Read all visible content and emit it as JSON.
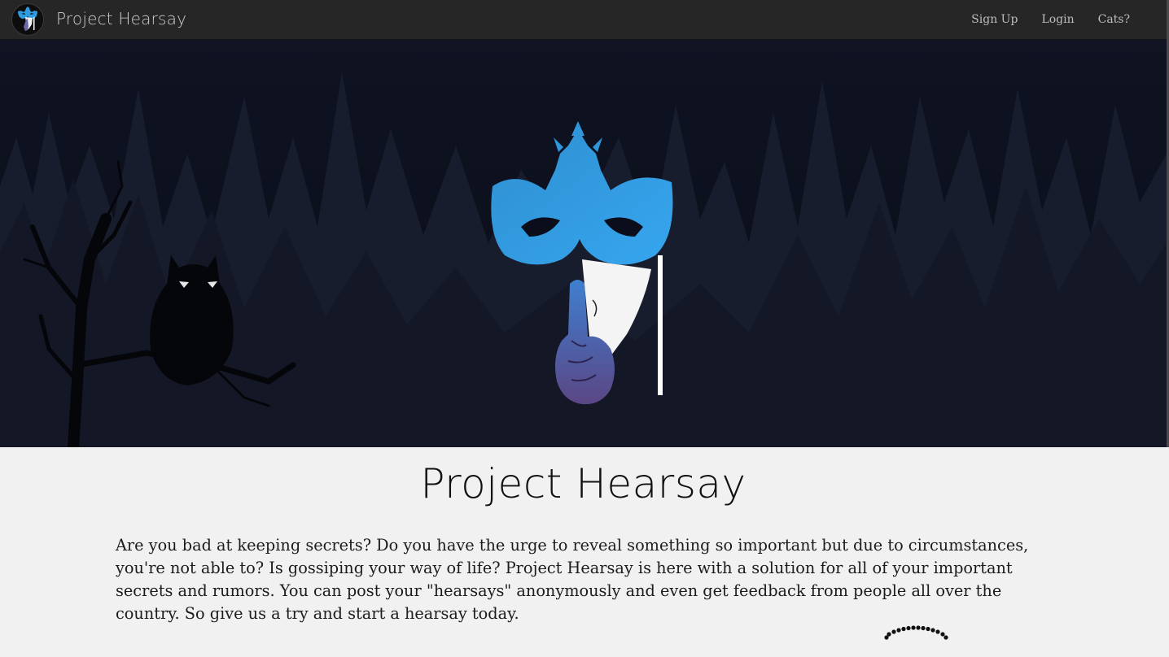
{
  "navbar": {
    "brand": "Project Hearsay",
    "logo_icon": "masquerade-mask-icon",
    "links": [
      {
        "label": "Sign Up"
      },
      {
        "label": "Login"
      },
      {
        "label": "Cats?"
      }
    ]
  },
  "hero": {
    "logo_icon": "masquerade-mask-shush-icon",
    "background": "night-forest-owl",
    "colors": {
      "background": "#0b0e1a",
      "mask_top": "#2fa7ee",
      "mask_bottom": "#5a4a88"
    }
  },
  "main": {
    "title": "Project Hearsay",
    "intro": "Are you bad at keeping secrets? Do you have the urge to reveal something so important but due to circumstances, you're not able to? Is gossiping your way of life? Project Hearsay is here with a solution for all of your important secrets and rumors. You can post your \"hearsays\" anonymously and even get feedback from people all over the country. So give us a try and start a hearsay today."
  }
}
